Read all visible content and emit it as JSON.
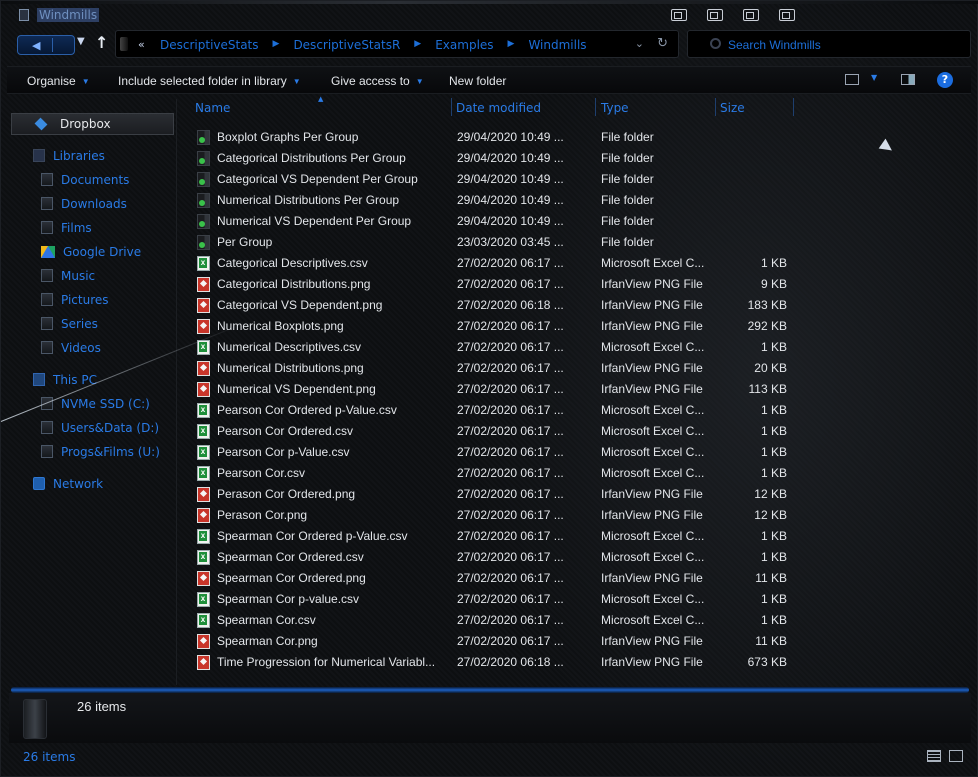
{
  "window": {
    "title": "Windmills"
  },
  "address": {
    "breadcrumbs": [
      "DescriptiveStats",
      "DescriptiveStatsR",
      "Examples",
      "Windmills"
    ],
    "overflow": "«"
  },
  "search": {
    "placeholder": "Search Windmills"
  },
  "toolbar": {
    "organise": "Organise",
    "include": "Include selected folder in library",
    "share": "Give access to",
    "new_folder": "New folder",
    "help": "?"
  },
  "sidebar": {
    "dropbox": "Dropbox",
    "libraries": "Libraries",
    "documents": "Documents",
    "downloads": "Downloads",
    "films": "Films",
    "google_drive": "Google Drive",
    "music": "Music",
    "pictures": "Pictures",
    "series": "Series",
    "videos": "Videos",
    "this_pc": "This PC",
    "nvme": "NVMe SSD (C:)",
    "users_data": "Users&Data (D:)",
    "progs_films": "Progs&Films (U:)",
    "network": "Network"
  },
  "columns": {
    "name": "Name",
    "date": "Date modified",
    "type": "Type",
    "size": "Size"
  },
  "files": [
    {
      "icon": "folder",
      "name": "Boxplot Graphs Per Group",
      "date": "29/04/2020 10:49 ...",
      "type": "File folder",
      "size": ""
    },
    {
      "icon": "folder",
      "name": "Categorical Distributions Per Group",
      "date": "29/04/2020 10:49 ...",
      "type": "File folder",
      "size": ""
    },
    {
      "icon": "folder",
      "name": "Categorical VS Dependent Per Group",
      "date": "29/04/2020 10:49 ...",
      "type": "File folder",
      "size": ""
    },
    {
      "icon": "folder",
      "name": "Numerical Distributions Per Group",
      "date": "29/04/2020 10:49 ...",
      "type": "File folder",
      "size": ""
    },
    {
      "icon": "folder",
      "name": "Numerical VS Dependent Per Group",
      "date": "29/04/2020 10:49 ...",
      "type": "File folder",
      "size": ""
    },
    {
      "icon": "folder",
      "name": "Per Group",
      "date": "23/03/2020 03:45 ...",
      "type": "File folder",
      "size": ""
    },
    {
      "icon": "csv",
      "name": "Categorical Descriptives.csv",
      "date": "27/02/2020 06:17 ...",
      "type": "Microsoft Excel C...",
      "size": "1 KB"
    },
    {
      "icon": "png",
      "name": "Categorical Distributions.png",
      "date": "27/02/2020 06:17 ...",
      "type": "IrfanView PNG File",
      "size": "9 KB"
    },
    {
      "icon": "png",
      "name": "Categorical VS Dependent.png",
      "date": "27/02/2020 06:18 ...",
      "type": "IrfanView PNG File",
      "size": "183 KB"
    },
    {
      "icon": "png",
      "name": "Numerical Boxplots.png",
      "date": "27/02/2020 06:17 ...",
      "type": "IrfanView PNG File",
      "size": "292 KB"
    },
    {
      "icon": "csv",
      "name": "Numerical Descriptives.csv",
      "date": "27/02/2020 06:17 ...",
      "type": "Microsoft Excel C...",
      "size": "1 KB"
    },
    {
      "icon": "png",
      "name": "Numerical Distributions.png",
      "date": "27/02/2020 06:17 ...",
      "type": "IrfanView PNG File",
      "size": "20 KB"
    },
    {
      "icon": "png",
      "name": "Numerical VS Dependent.png",
      "date": "27/02/2020 06:17 ...",
      "type": "IrfanView PNG File",
      "size": "113 KB"
    },
    {
      "icon": "csv",
      "name": "Pearson Cor Ordered p-Value.csv",
      "date": "27/02/2020 06:17 ...",
      "type": "Microsoft Excel C...",
      "size": "1 KB"
    },
    {
      "icon": "csv",
      "name": "Pearson Cor Ordered.csv",
      "date": "27/02/2020 06:17 ...",
      "type": "Microsoft Excel C...",
      "size": "1 KB"
    },
    {
      "icon": "csv",
      "name": "Pearson Cor p-Value.csv",
      "date": "27/02/2020 06:17 ...",
      "type": "Microsoft Excel C...",
      "size": "1 KB"
    },
    {
      "icon": "csv",
      "name": "Pearson Cor.csv",
      "date": "27/02/2020 06:17 ...",
      "type": "Microsoft Excel C...",
      "size": "1 KB"
    },
    {
      "icon": "png",
      "name": "Perason Cor Ordered.png",
      "date": "27/02/2020 06:17 ...",
      "type": "IrfanView PNG File",
      "size": "12 KB"
    },
    {
      "icon": "png",
      "name": "Perason Cor.png",
      "date": "27/02/2020 06:17 ...",
      "type": "IrfanView PNG File",
      "size": "12 KB"
    },
    {
      "icon": "csv",
      "name": "Spearman Cor Ordered p-Value.csv",
      "date": "27/02/2020 06:17 ...",
      "type": "Microsoft Excel C...",
      "size": "1 KB"
    },
    {
      "icon": "csv",
      "name": "Spearman Cor Ordered.csv",
      "date": "27/02/2020 06:17 ...",
      "type": "Microsoft Excel C...",
      "size": "1 KB"
    },
    {
      "icon": "png",
      "name": "Spearman Cor Ordered.png",
      "date": "27/02/2020 06:17 ...",
      "type": "IrfanView PNG File",
      "size": "11 KB"
    },
    {
      "icon": "csv",
      "name": "Spearman Cor p-value.csv",
      "date": "27/02/2020 06:17 ...",
      "type": "Microsoft Excel C...",
      "size": "1 KB"
    },
    {
      "icon": "csv",
      "name": "Spearman Cor.csv",
      "date": "27/02/2020 06:17 ...",
      "type": "Microsoft Excel C...",
      "size": "1 KB"
    },
    {
      "icon": "png",
      "name": "Spearman Cor.png",
      "date": "27/02/2020 06:17 ...",
      "type": "IrfanView PNG File",
      "size": "11 KB"
    },
    {
      "icon": "png",
      "name": "Time Progression for Numerical Variabl...",
      "date": "27/02/2020 06:18 ...",
      "type": "IrfanView PNG File",
      "size": "673 KB"
    }
  ],
  "details": {
    "item_count": "26 items"
  },
  "status": {
    "item_count": "26 items"
  },
  "colors": {
    "accent": "#2a7be6",
    "background": "#0d0f11",
    "text": "#e3e6ea"
  }
}
